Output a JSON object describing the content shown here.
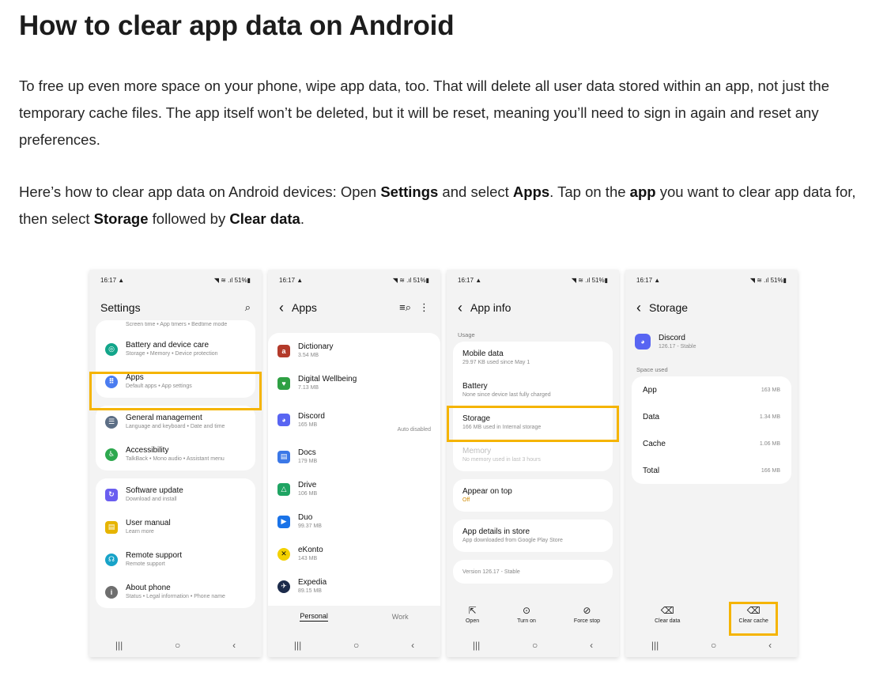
{
  "article": {
    "title": "How to clear app data on Android",
    "p1": "To free up even more space on your phone, wipe app data, too. That will delete all user data stored within an app, not just the temporary cache files. The app itself won’t be deleted, but it will be reset, meaning you’ll need to sign in again and reset any preferences.",
    "p2": {
      "s1": "Here’s how to clear app data on Android devices: Open ",
      "b1": "Settings",
      "s2": " and select ",
      "b2": "Apps",
      "s3": ". Tap on the ",
      "b3": "app",
      "s4": " you want to clear app data for, then select ",
      "b4": "Storage",
      "s5": " followed by ",
      "b5": "Clear data",
      "s6": "."
    }
  },
  "status": {
    "time": "16:17 ▲",
    "right": "◥ ≋ .ıl 51%▮"
  },
  "nav": {
    "recent": "|||",
    "home": "○",
    "back": "‹"
  },
  "colors": {
    "highlight": "#f5b400"
  },
  "phone1": {
    "title": "Settings",
    "search_icon": "⌕",
    "top_partial": "Screen time  •  App timers  •  Bedtime mode",
    "items": [
      {
        "t1": "Battery and device care",
        "t2": "Storage  •  Memory  •  Device protection",
        "icon": "◎",
        "color": "#12a58a"
      },
      {
        "t1": "Apps",
        "t2": "Default apps  •  App settings",
        "icon": "⠿",
        "color": "#4a7cf0"
      },
      {
        "t1": "General management",
        "t2": "Language and keyboard  •  Date and time",
        "icon": "☰",
        "color": "#5c6e85"
      },
      {
        "t1": "Accessibility",
        "t2": "TalkBack  •  Mono audio  •  Assistant menu",
        "icon": "♿",
        "color": "#2da84e"
      },
      {
        "t1": "Software update",
        "t2": "Download and install",
        "icon": "↻",
        "color": "#6a5ef0"
      },
      {
        "t1": "User manual",
        "t2": "Learn more",
        "icon": "▤",
        "color": "#e6b400"
      },
      {
        "t1": "Remote support",
        "t2": "Remote support",
        "icon": "☊",
        "color": "#17a3c8"
      },
      {
        "t1": "About phone",
        "t2": "Status  •  Legal information  •  Phone name",
        "icon": "i",
        "color": "#6e6e6e"
      }
    ]
  },
  "phone2": {
    "title": "Apps",
    "back_icon": "‹",
    "filter_icon": "≡⌕",
    "more_icon": "⋮",
    "items": [
      {
        "t1": "Dictionary",
        "t2": "3.54 MB",
        "icon": "a",
        "color": "#b33a2a",
        "right": ""
      },
      {
        "t1": "Digital Wellbeing",
        "t2": "7.13 MB",
        "icon": "♥",
        "color": "#2ea043",
        "right": ""
      },
      {
        "t1": "Discord",
        "t2": "165 MB",
        "icon": "◕",
        "color": "#5865f2",
        "right": "Auto disabled"
      },
      {
        "t1": "Docs",
        "t2": "179 MB",
        "icon": "▤",
        "color": "#3b78e7",
        "right": ""
      },
      {
        "t1": "Drive",
        "t2": "106 MB",
        "icon": "△",
        "color": "#1fa463",
        "right": ""
      },
      {
        "t1": "Duo",
        "t2": "99.37 MB",
        "icon": "▶",
        "color": "#1a73e8",
        "right": ""
      },
      {
        "t1": "eKonto",
        "t2": "143 MB",
        "icon": "✕",
        "color": "#f3d100",
        "right": ""
      },
      {
        "t1": "Expedia",
        "t2": "89.15 MB",
        "icon": "✈",
        "color": "#1c2b4b",
        "right": ""
      }
    ],
    "tabs": {
      "personal": "Personal",
      "work": "Work"
    }
  },
  "phone3": {
    "title": "App info",
    "back_icon": "‹",
    "usage_label": "Usage",
    "items": [
      {
        "t1": "Mobile data",
        "t2": "29.97 KB used since May 1"
      },
      {
        "t1": "Battery",
        "t2": "None since device last fully charged"
      },
      {
        "t1": "Storage",
        "t2": "166 MB used in Internal storage"
      },
      {
        "t1": "Memory",
        "t2": "No memory used in last 3 hours"
      }
    ],
    "appear": {
      "t1": "Appear on top",
      "t2": "Off"
    },
    "details": {
      "t1": "App details in store",
      "t2": "App downloaded from Google Play Store"
    },
    "version": "Version 126.17 - Stable",
    "actions": [
      {
        "label": "Open",
        "icon": "⇱"
      },
      {
        "label": "Turn on",
        "icon": "⊙"
      },
      {
        "label": "Force stop",
        "icon": "⊘"
      }
    ]
  },
  "phone4": {
    "title": "Storage",
    "back_icon": "‹",
    "app_name": "Discord",
    "app_version": "126.17 - Stable",
    "space_label": "Space used",
    "rows": [
      {
        "k": "App",
        "v": "163 MB"
      },
      {
        "k": "Data",
        "v": "1.34 MB"
      },
      {
        "k": "Cache",
        "v": "1.06 MB"
      },
      {
        "k": "Total",
        "v": "166 MB"
      }
    ],
    "actions": [
      {
        "label": "Clear data",
        "icon": "⌫"
      },
      {
        "label": "Clear cache",
        "icon": "⌫"
      }
    ]
  }
}
